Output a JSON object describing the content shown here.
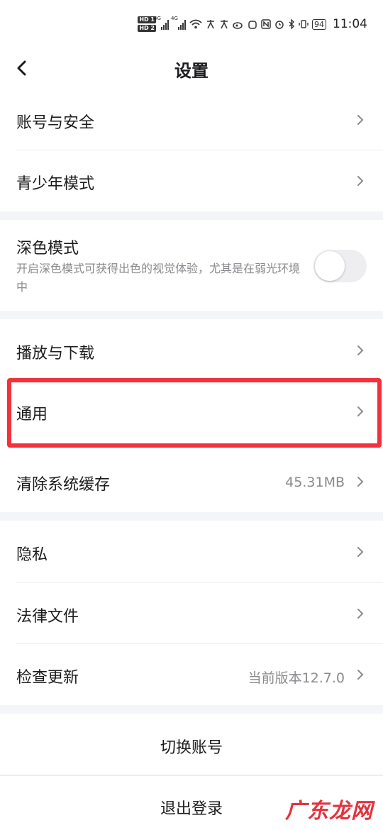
{
  "status_bar": {
    "hd1": "HD 1",
    "hd2": "HD 2",
    "net1": "4G",
    "net2": "4G",
    "battery": "94",
    "time": "11:04"
  },
  "header": {
    "title": "设置"
  },
  "settings": {
    "account_security": "账号与安全",
    "teen_mode": "青少年模式",
    "dark_mode": "深色模式",
    "dark_mode_desc": "开启深色模式可获得出色的视觉体验，尤其是在弱光环境中",
    "dark_mode_on": false,
    "playback_download": "播放与下载",
    "general": "通用",
    "clear_cache": "清除系统缓存",
    "cache_size": "45.31MB",
    "privacy": "隐私",
    "legal": "法律文件",
    "check_update": "检查更新",
    "current_version": "当前版本12.7.0"
  },
  "actions": {
    "switch_account": "切换账号",
    "logout": "退出登录"
  },
  "watermark": "广东龙网",
  "colors": {
    "highlight": "#f4313a",
    "section_gap": "#f4f5f8",
    "secondary_text": "#8a8a8e"
  }
}
